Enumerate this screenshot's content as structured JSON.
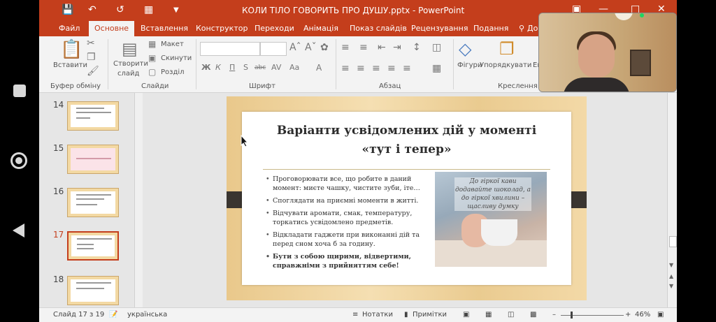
{
  "app": {
    "title": "КОЛИ ТІЛО ГОВОРИТЬ ПРО ДУШУ.pptx - PowerPoint",
    "accent": "#c43e1c"
  },
  "tabs": [
    {
      "label": "Файл"
    },
    {
      "label": "Основне"
    },
    {
      "label": "Вставлення"
    },
    {
      "label": "Конструктор"
    },
    {
      "label": "Переходи"
    },
    {
      "label": "Анімація"
    },
    {
      "label": "Показ слайдів"
    },
    {
      "label": "Рецензування"
    },
    {
      "label": "Подання"
    },
    {
      "label": "Дo"
    }
  ],
  "ribbon": {
    "paste_label": "Вставити",
    "clipboard_group": "Буфер обміну",
    "new_slide_label_1": "Створити",
    "new_slide_label_2": "слайд",
    "layout_label": "Макет",
    "reset_label": "Скинути",
    "section_label": "Розділ",
    "slides_group": "Слайди",
    "font_group": "Шрифт",
    "paragraph_group": "Абзац",
    "shapes_label": "Фігури",
    "arrange_label": "Упорядкувати",
    "styles_label": "Ек",
    "drawing_group": "Креслення",
    "font_buttons": [
      "Ж",
      "К",
      "П",
      "S",
      "abc",
      "AV",
      "Aa",
      "A"
    ]
  },
  "thumbnails": [
    {
      "number": "14"
    },
    {
      "number": "15"
    },
    {
      "number": "16"
    },
    {
      "number": "17"
    },
    {
      "number": "18"
    }
  ],
  "slide": {
    "title": "Варіанти усвідомлених дій у моменті «тут і тепер»",
    "bullets": [
      "Проговорювати все, що робите в даний момент: миєте чашку, чистите зуби, іте…",
      "Споглядати на приємні моменти в житті.",
      "Відчувати аромати, смак, температуру, торкатись усвідомлено предметів.",
      "Відкладати гаджети при виконанні дій та перед сном хоча б за годину.",
      "Бути з собою щирими, відвертими, справжніми з прийняттям себе!"
    ],
    "photo_caption": "До гіркої кави додавайте шоколад, а до гіркої хвилини – щасливу думку"
  },
  "status": {
    "slide_counter": "Слайд 17 з 19",
    "language": "українська",
    "notes_label": "Нотатки",
    "comments_label": "Примітки",
    "zoom": "46%"
  }
}
